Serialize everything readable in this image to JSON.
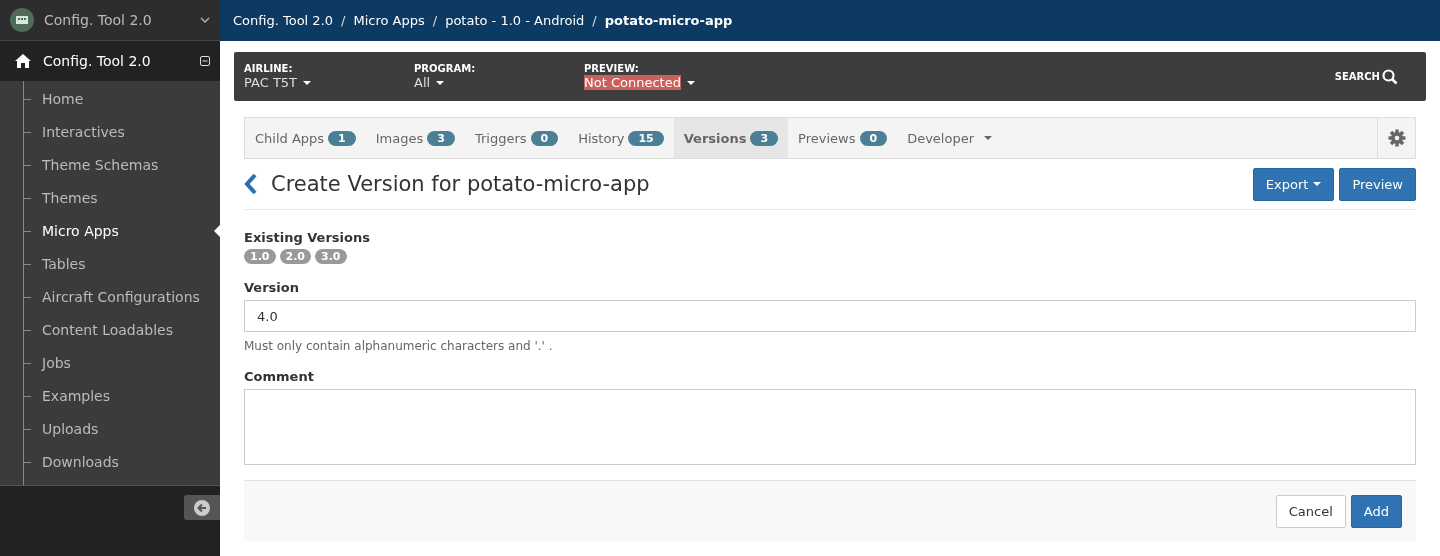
{
  "app_switcher": {
    "title": "Config. Tool 2.0"
  },
  "sidebar": {
    "root": {
      "label": "Config. Tool 2.0",
      "expanded": true
    },
    "items": [
      {
        "label": "Home",
        "selected": false
      },
      {
        "label": "Interactives",
        "selected": false
      },
      {
        "label": "Theme Schemas",
        "selected": false
      },
      {
        "label": "Themes",
        "selected": false
      },
      {
        "label": "Micro Apps",
        "selected": true
      },
      {
        "label": "Tables",
        "selected": false
      },
      {
        "label": "Aircraft Configurations",
        "selected": false
      },
      {
        "label": "Content Loadables",
        "selected": false
      },
      {
        "label": "Jobs",
        "selected": false
      },
      {
        "label": "Examples",
        "selected": false
      },
      {
        "label": "Uploads",
        "selected": false
      },
      {
        "label": "Downloads",
        "selected": false
      }
    ]
  },
  "breadcrumbs": [
    {
      "label": "Config. Tool 2.0"
    },
    {
      "separator": "/",
      "label": "Micro Apps"
    },
    {
      "separator": "/",
      "label": "potato - 1.0 - Android"
    },
    {
      "separator": "/",
      "label": "potato-micro-app"
    }
  ],
  "filters": [
    {
      "label": "AIRLINE:",
      "value": "PAC T5T",
      "warning": false
    },
    {
      "label": "PROGRAM:",
      "value": "All",
      "warning": false
    },
    {
      "label": "PREVIEW:",
      "value": "Not Connected",
      "warning": true
    }
  ],
  "search": {
    "label": "SEARCH"
  },
  "tabs": [
    {
      "label": "Child Apps",
      "count": "1",
      "selected": false
    },
    {
      "label": "Images",
      "count": "3",
      "selected": false
    },
    {
      "label": "Triggers",
      "count": "0",
      "selected": false
    },
    {
      "label": "History",
      "count": "15",
      "selected": false
    },
    {
      "label": "Versions",
      "count": "3",
      "selected": true
    },
    {
      "label": "Previews",
      "count": "0",
      "selected": false
    },
    {
      "label": "Developer",
      "selected": false
    }
  ],
  "page": {
    "title": "Create Version for potato-micro-app",
    "actions": [
      {
        "label": "Export",
        "dropdown": true
      },
      {
        "label": "Preview",
        "dropdown": false
      }
    ]
  },
  "existing_versions": {
    "label": "Existing Versions",
    "versions": [
      "1.0",
      "2.0",
      "3.0"
    ]
  },
  "version_field": {
    "label": "Version",
    "value": "4.0",
    "help": "Must only contain alphanumeric characters and '.' ."
  },
  "comment_field": {
    "label": "Comment"
  },
  "footer": {
    "buttons": [
      {
        "label": "Cancel",
        "primary": false
      },
      {
        "label": "Add",
        "primary": true
      }
    ]
  }
}
